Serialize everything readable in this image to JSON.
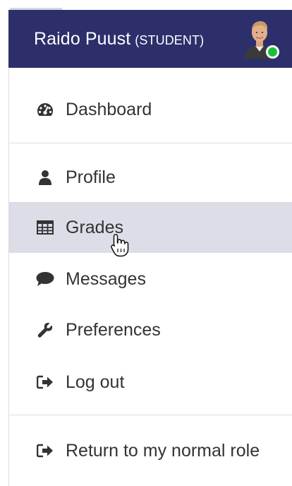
{
  "header": {
    "user_name": "Raido Puust",
    "user_role": "(STUDENT)",
    "avatar": "user-avatar",
    "status_color": "#19c13a",
    "background_color": "#2d2f6b"
  },
  "menu": {
    "dashboard": {
      "label": "Dashboard",
      "icon": "dashboard-gauge-icon"
    },
    "profile": {
      "label": "Profile",
      "icon": "user-icon"
    },
    "grades": {
      "label": "Grades",
      "icon": "table-grid-icon",
      "state": "hover"
    },
    "messages": {
      "label": "Messages",
      "icon": "speech-bubble-icon"
    },
    "preferences": {
      "label": "Preferences",
      "icon": "wrench-icon"
    },
    "logout": {
      "label": "Log out",
      "icon": "sign-out-icon"
    },
    "return_role": {
      "label": "Return to my normal role",
      "icon": "sign-out-icon"
    }
  },
  "cursor": {
    "icon": "hand-pointer-cursor"
  }
}
